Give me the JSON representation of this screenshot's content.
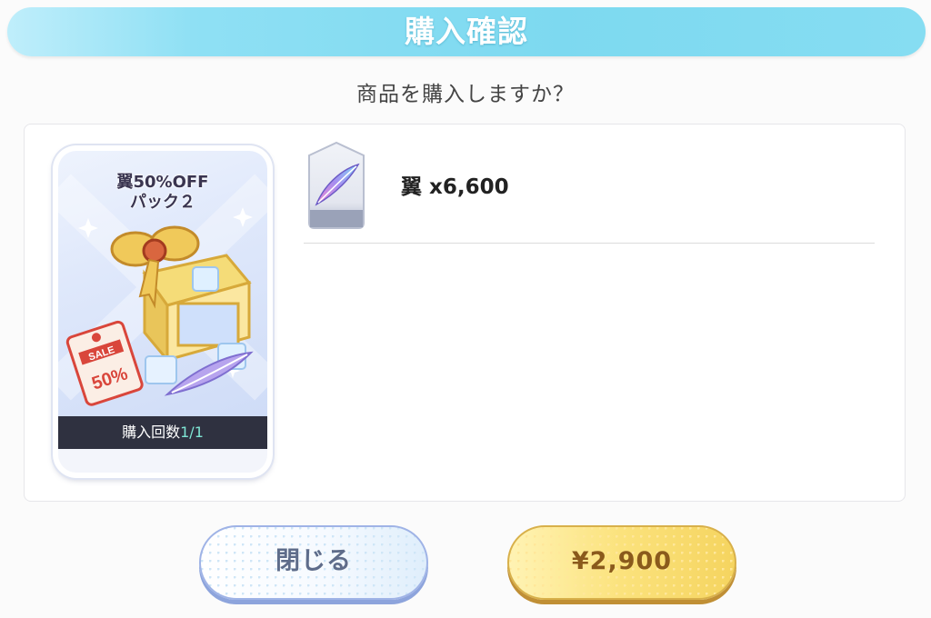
{
  "dialog": {
    "title": "購入確認",
    "question": "商品を購入しますか？"
  },
  "product": {
    "name_line1": "翼50%OFF",
    "name_line2": "パック２",
    "sale_tag": "SALE",
    "discount_tag": "50%",
    "purchase_count_label": "購入回数",
    "purchase_count_value": "1/1"
  },
  "contents": [
    {
      "icon": "feather-icon",
      "label": "翼 x6,600"
    }
  ],
  "buttons": {
    "close_label": "閉じる",
    "buy_label": "¥2,900"
  },
  "colors": {
    "title_bar": "#7dd9f0",
    "count_bar": "#2f3140",
    "count_value": "#7fe6d4",
    "buy_button": "#f5d45f",
    "close_button_border": "#9fb3e6"
  }
}
